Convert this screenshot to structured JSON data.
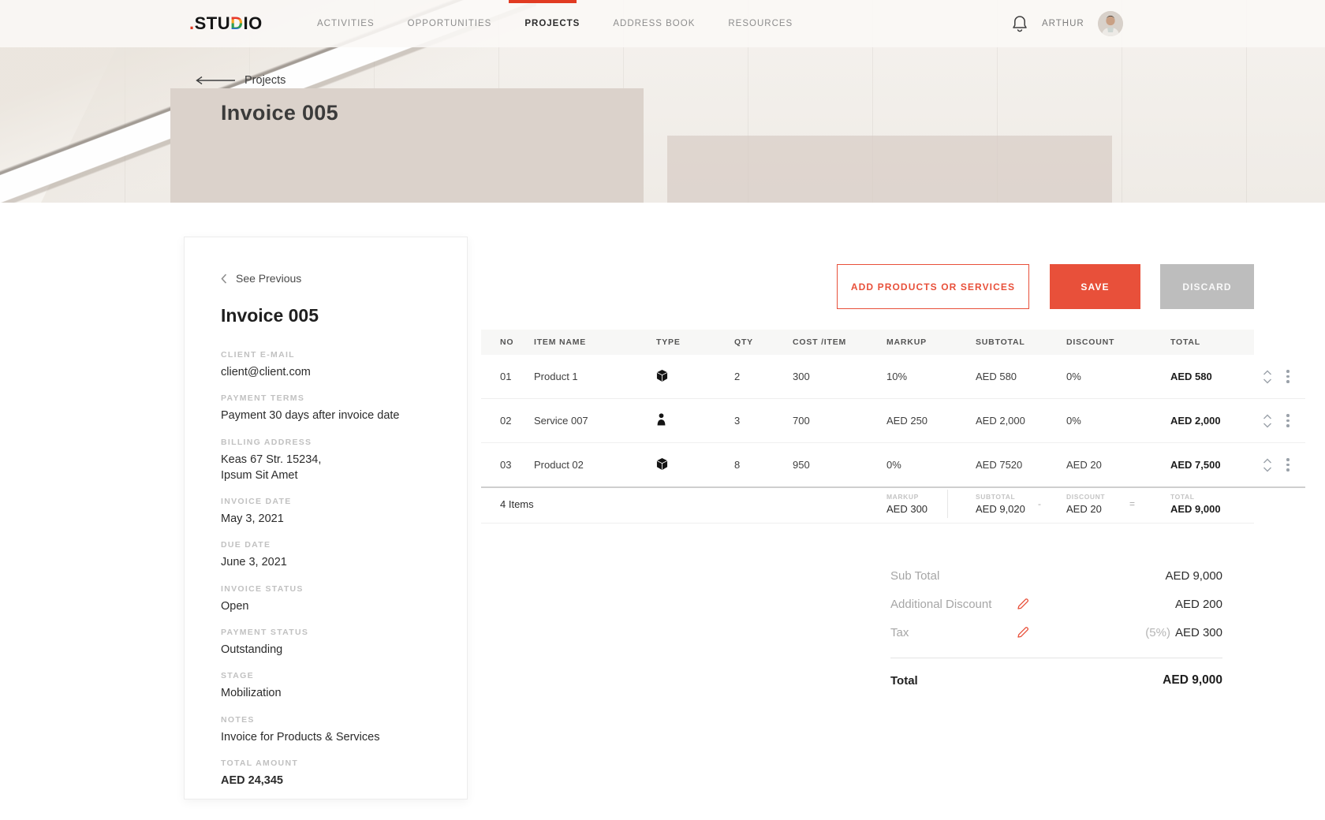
{
  "brand": {
    "dot": ".",
    "pre": "STU",
    "d": "D",
    "post": "IO"
  },
  "nav": {
    "items": [
      {
        "label": "ACTIVITIES"
      },
      {
        "label": "OPPORTUNITIES"
      },
      {
        "label": "PROJECTS"
      },
      {
        "label": "ADDRESS BOOK"
      },
      {
        "label": "RESOURCES"
      }
    ],
    "active_item": "PROJECTS",
    "user_name": "ARTHUR"
  },
  "hero": {
    "breadcrumb": "Projects",
    "title": "Invoice 005"
  },
  "panel": {
    "back": "See Previous",
    "title": "Invoice 005",
    "fields": [
      {
        "label": "CLIENT E-MAIL",
        "value": "client@client.com"
      },
      {
        "label": "PAYMENT TERMS",
        "value": "Payment 30 days after invoice date"
      },
      {
        "label": "BILLING ADDRESS",
        "value": "Keas 67 Str. 15234,",
        "value2": "Ipsum Sit Amet"
      },
      {
        "label": "INVOICE DATE",
        "value": "May 3, 2021"
      },
      {
        "label": "DUE DATE",
        "value": "June 3, 2021"
      },
      {
        "label": "INVOICE STATUS",
        "value": "Open"
      },
      {
        "label": "PAYMENT STATUS",
        "value": "Outstanding"
      },
      {
        "label": "STAGE",
        "value": "Mobilization"
      },
      {
        "label": "NOTES",
        "value": "Invoice for Products & Services"
      },
      {
        "label": "TOTAL AMOUNT",
        "value": "AED 24,345"
      }
    ]
  },
  "actions": {
    "add": "ADD PRODUCTS OR SERVICES",
    "save": "SAVE",
    "discard": "DISCARD"
  },
  "table": {
    "columns": [
      "NO",
      "ITEM NAME",
      "TYPE",
      "QTY",
      "COST /ITEM",
      "MARKUP",
      "SUBTOTAL",
      "DISCOUNT",
      "TOTAL"
    ],
    "rows": [
      {
        "no": "01",
        "name": "Product 1",
        "type_icon": "cube-icon",
        "qty": "2",
        "cost": "300",
        "markup": "10%",
        "subtotal": "AED 580",
        "discount": "0%",
        "total": "AED 580"
      },
      {
        "no": "02",
        "name": "Service 007",
        "type_icon": "person-icon",
        "qty": "3",
        "cost": "700",
        "markup": "AED 250",
        "subtotal": "AED 2,000",
        "discount": "0%",
        "total": "AED 2,000"
      },
      {
        "no": "03",
        "name": "Product 02",
        "type_icon": "cube-icon",
        "qty": "8",
        "cost": "950",
        "markup": "0%",
        "subtotal": "AED 7520",
        "discount": "AED 20",
        "total": "AED 7,500"
      }
    ],
    "footer": {
      "items_count": "4 Items",
      "markup_label": "MARKUP",
      "markup_value": "AED 300",
      "subtotal_label": "SUBTOTAL",
      "subtotal_value": "AED 9,020",
      "minus": "-",
      "discount_label": "DISCOUNT",
      "discount_value": "AED 20",
      "equals": "=",
      "total_label": "TOTAL",
      "total_value": "AED 9,000"
    }
  },
  "summary": {
    "subtotal_label": "Sub Total",
    "subtotal_value": "AED 9,000",
    "discount_label": "Additional Discount",
    "discount_value": "AED 200",
    "tax_label": "Tax",
    "tax_rate": "(5%)",
    "tax_value": "AED 300",
    "total_label": "Total",
    "total_value": "AED 9,000"
  },
  "colors": {
    "accent": "#E8503A",
    "tab_indicator": "#E13B22",
    "discard_gray": "#BDBDBD"
  }
}
